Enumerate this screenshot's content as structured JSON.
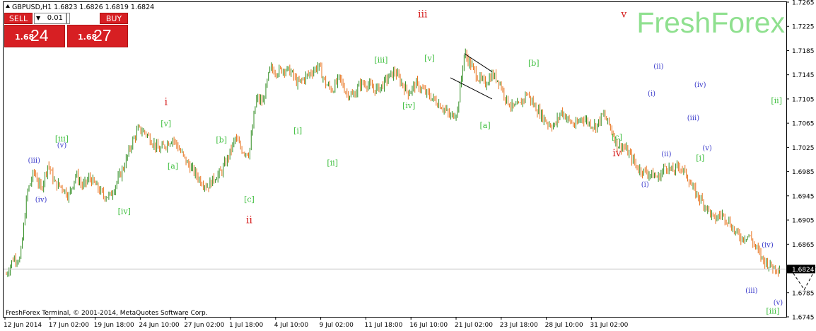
{
  "window": {
    "title": "GBPUSD,H1  1.6823 1.6826 1.6819 1.6824"
  },
  "watermark": "FreshForex",
  "copyright": "FreshForex Terminal, © 2001-2014, MetaQuotes Software Corp.",
  "trade_panel": {
    "sell_label": "SELL",
    "buy_label": "BUY",
    "lot_value": "0.01",
    "sell_price_small": "1.68",
    "sell_price_big": "24",
    "buy_price_small": "1.68",
    "buy_price_big": "27",
    "accent": "#d71f23"
  },
  "chart_data": {
    "type": "candlestick",
    "symbol": "GBPUSD",
    "timeframe": "H1",
    "ohlc_last": {
      "open": 1.6823,
      "high": 1.6826,
      "low": 1.6819,
      "close": 1.6824
    },
    "current_price": 1.6824,
    "current_price_label": "1.6824",
    "ylim": [
      1.6745,
      1.7265
    ],
    "y_ticks": [
      "1.7265",
      "1.7225",
      "1.7185",
      "1.7145",
      "1.7105",
      "1.7065",
      "1.7025",
      "1.6985",
      "1.6945",
      "1.6905",
      "1.6865",
      "1.6824",
      "1.6785",
      "1.6745"
    ],
    "x_ticks": [
      "12 Jun 2014",
      "17 Jun 02:00",
      "19 Jun 18:00",
      "24 Jun 10:00",
      "27 Jun 02:00",
      "1 Jul 18:00",
      "4 Jul 10:00",
      "9 Jul 02:00",
      "11 Jul 18:00",
      "16 Jul 10:00",
      "21 Jul 02:00",
      "23 Jul 18:00",
      "28 Jul 10:00",
      "31 Jul 02:00"
    ],
    "colors": {
      "up": "#2e8b1f",
      "down": "#e8701a",
      "wave_major": "#d62020",
      "wave_green": "#3fbf3f",
      "wave_blue": "#3a3acb"
    },
    "price_path": [
      [
        0,
        1.6815
      ],
      [
        1,
        1.6842
      ],
      [
        2,
        1.684
      ],
      [
        3,
        1.695
      ],
      [
        4,
        1.6985
      ],
      [
        5,
        1.6955
      ],
      [
        6,
        1.6998
      ],
      [
        7,
        1.6965
      ],
      [
        8,
        1.696
      ],
      [
        9,
        1.6945
      ],
      [
        10,
        1.698
      ],
      [
        11,
        1.696
      ],
      [
        12,
        1.6975
      ],
      [
        13,
        1.696
      ],
      [
        14,
        1.6945
      ],
      [
        15,
        1.6945
      ],
      [
        16,
        1.697
      ],
      [
        17,
        1.6995
      ],
      [
        18,
        1.703
      ],
      [
        19,
        1.7055
      ],
      [
        20,
        1.705
      ],
      [
        21,
        1.7035
      ],
      [
        22,
        1.702
      ],
      [
        23,
        1.703
      ],
      [
        24,
        1.704
      ],
      [
        25,
        1.702
      ],
      [
        26,
        1.7
      ],
      [
        27,
        1.6985
      ],
      [
        28,
        1.697
      ],
      [
        29,
        1.696
      ],
      [
        30,
        1.6975
      ],
      [
        31,
        1.6985
      ],
      [
        32,
        1.701
      ],
      [
        33,
        1.704
      ],
      [
        34,
        1.702
      ],
      [
        35,
        1.7015
      ],
      [
        36,
        1.7105
      ],
      [
        37,
        1.71
      ],
      [
        38,
        1.7155
      ],
      [
        39,
        1.715
      ],
      [
        40,
        1.7155
      ],
      [
        41,
        1.715
      ],
      [
        42,
        1.713
      ],
      [
        43,
        1.714
      ],
      [
        44,
        1.715
      ],
      [
        45,
        1.716
      ],
      [
        46,
        1.713
      ],
      [
        47,
        1.712
      ],
      [
        48,
        1.714
      ],
      [
        49,
        1.7115
      ],
      [
        50,
        1.711
      ],
      [
        51,
        1.713
      ],
      [
        52,
        1.713
      ],
      [
        53,
        1.712
      ],
      [
        54,
        1.7125
      ],
      [
        55,
        1.714
      ],
      [
        56,
        1.715
      ],
      [
        57,
        1.713
      ],
      [
        58,
        1.7115
      ],
      [
        59,
        1.713
      ],
      [
        60,
        1.712
      ],
      [
        61,
        1.711
      ],
      [
        62,
        1.71
      ],
      [
        63,
        1.709
      ],
      [
        64,
        1.7075
      ],
      [
        65,
        1.7085
      ],
      [
        66,
        1.718
      ],
      [
        67,
        1.716
      ],
      [
        68,
        1.714
      ],
      [
        69,
        1.713
      ],
      [
        70,
        1.7145
      ],
      [
        71,
        1.7135
      ],
      [
        72,
        1.7105
      ],
      [
        73,
        1.709
      ],
      [
        74,
        1.7095
      ],
      [
        75,
        1.7115
      ],
      [
        76,
        1.7095
      ],
      [
        77,
        1.708
      ],
      [
        78,
        1.7065
      ],
      [
        79,
        1.706
      ],
      [
        80,
        1.7085
      ],
      [
        81,
        1.707
      ],
      [
        82,
        1.706
      ],
      [
        83,
        1.7075
      ],
      [
        84,
        1.7065
      ],
      [
        85,
        1.706
      ],
      [
        86,
        1.708
      ],
      [
        87,
        1.706
      ],
      [
        88,
        1.703
      ],
      [
        89,
        1.7025
      ],
      [
        90,
        1.701
      ],
      [
        91,
        1.699
      ],
      [
        92,
        1.6985
      ],
      [
        93,
        1.698
      ],
      [
        94,
        1.6975
      ],
      [
        95,
        1.6995
      ],
      [
        96,
        1.6985
      ],
      [
        97,
        1.6995
      ],
      [
        98,
        1.698
      ],
      [
        99,
        1.6955
      ],
      [
        100,
        1.694
      ],
      [
        101,
        1.6925
      ],
      [
        102,
        1.6905
      ],
      [
        103,
        1.6915
      ],
      [
        104,
        1.6905
      ],
      [
        105,
        1.6885
      ],
      [
        106,
        1.6875
      ],
      [
        107,
        1.688
      ],
      [
        108,
        1.686
      ],
      [
        109,
        1.684
      ],
      [
        110,
        1.683
      ],
      [
        111,
        1.6826
      ],
      [
        112,
        1.6824
      ]
    ],
    "projection": [
      [
        113,
        1.6824
      ],
      [
        115,
        1.679
      ],
      [
        119,
        1.6875
      ]
    ],
    "trend_channel": [
      [
        [
          66,
          1.718
        ],
        [
          70,
          1.715
        ]
      ],
      [
        [
          64,
          1.714
        ],
        [
          70,
          1.7105
        ]
      ]
    ],
    "annotations": [
      {
        "text": "iii",
        "bar": 60,
        "price": 1.724,
        "group": "major"
      },
      {
        "text": "v",
        "bar": 89,
        "price": 1.724,
        "group": "major"
      },
      {
        "text": "i",
        "bar": 23,
        "price": 1.7095,
        "group": "major"
      },
      {
        "text": "ii",
        "bar": 35,
        "price": 1.69,
        "group": "major"
      },
      {
        "text": "iv",
        "bar": 88,
        "price": 1.701,
        "group": "major"
      },
      {
        "text": "[iii]",
        "bar": 54,
        "price": 1.7165,
        "group": "green"
      },
      {
        "text": "[v]",
        "bar": 61,
        "price": 1.7168,
        "group": "green"
      },
      {
        "text": "[iv]",
        "bar": 58,
        "price": 1.709,
        "group": "green"
      },
      {
        "text": "[a]",
        "bar": 69,
        "price": 1.7057,
        "group": "green"
      },
      {
        "text": "[b]",
        "bar": 76,
        "price": 1.716,
        "group": "green"
      },
      {
        "text": "[c]",
        "bar": 88,
        "price": 1.7038,
        "group": "green"
      },
      {
        "text": "[ii]",
        "bar": 111,
        "price": 1.7098,
        "group": "green"
      },
      {
        "text": "[i]",
        "bar": 100,
        "price": 1.7003,
        "group": "green"
      },
      {
        "text": "[iii]",
        "bar": 8,
        "price": 1.7035,
        "group": "green"
      },
      {
        "text": "[iv]",
        "bar": 17,
        "price": 1.6915,
        "group": "green"
      },
      {
        "text": "[v]",
        "bar": 23,
        "price": 1.706,
        "group": "green"
      },
      {
        "text": "[a]",
        "bar": 24,
        "price": 1.699,
        "group": "green"
      },
      {
        "text": "[b]",
        "bar": 31,
        "price": 1.7033,
        "group": "green"
      },
      {
        "text": "[c]",
        "bar": 35,
        "price": 1.6935,
        "group": "green"
      },
      {
        "text": "[i]",
        "bar": 42,
        "price": 1.7048,
        "group": "green"
      },
      {
        "text": "[ii]",
        "bar": 47,
        "price": 1.6995,
        "group": "green"
      },
      {
        "text": "[iii]",
        "bar": 144,
        "price": 1.675,
        "group": "green"
      },
      {
        "text": "(iii)",
        "bar": 4,
        "price": 1.7,
        "group": "blue"
      },
      {
        "text": "(v)",
        "bar": 8,
        "price": 1.7025,
        "group": "blue"
      },
      {
        "text": "(iv)",
        "bar": 5,
        "price": 1.6935,
        "group": "blue"
      },
      {
        "text": "(ii)",
        "bar": 94,
        "price": 1.7155,
        "group": "blue"
      },
      {
        "text": "(i)",
        "bar": 93,
        "price": 1.711,
        "group": "blue"
      },
      {
        "text": "(iv)",
        "bar": 100,
        "price": 1.7125,
        "group": "blue"
      },
      {
        "text": "(iii)",
        "bar": 99,
        "price": 1.707,
        "group": "blue"
      },
      {
        "text": "(v)",
        "bar": 101,
        "price": 1.702,
        "group": "blue"
      },
      {
        "text": "(ii)",
        "bar": 124,
        "price": 1.701,
        "group": "blue"
      },
      {
        "text": "(i)",
        "bar": 120,
        "price": 1.696,
        "group": "blue"
      },
      {
        "text": "(iv)",
        "bar": 143,
        "price": 1.686,
        "group": "blue"
      },
      {
        "text": "(iii)",
        "bar": 140,
        "price": 1.6785,
        "group": "blue"
      },
      {
        "text": "(v)",
        "bar": 145,
        "price": 1.6765,
        "group": "blue"
      }
    ]
  }
}
